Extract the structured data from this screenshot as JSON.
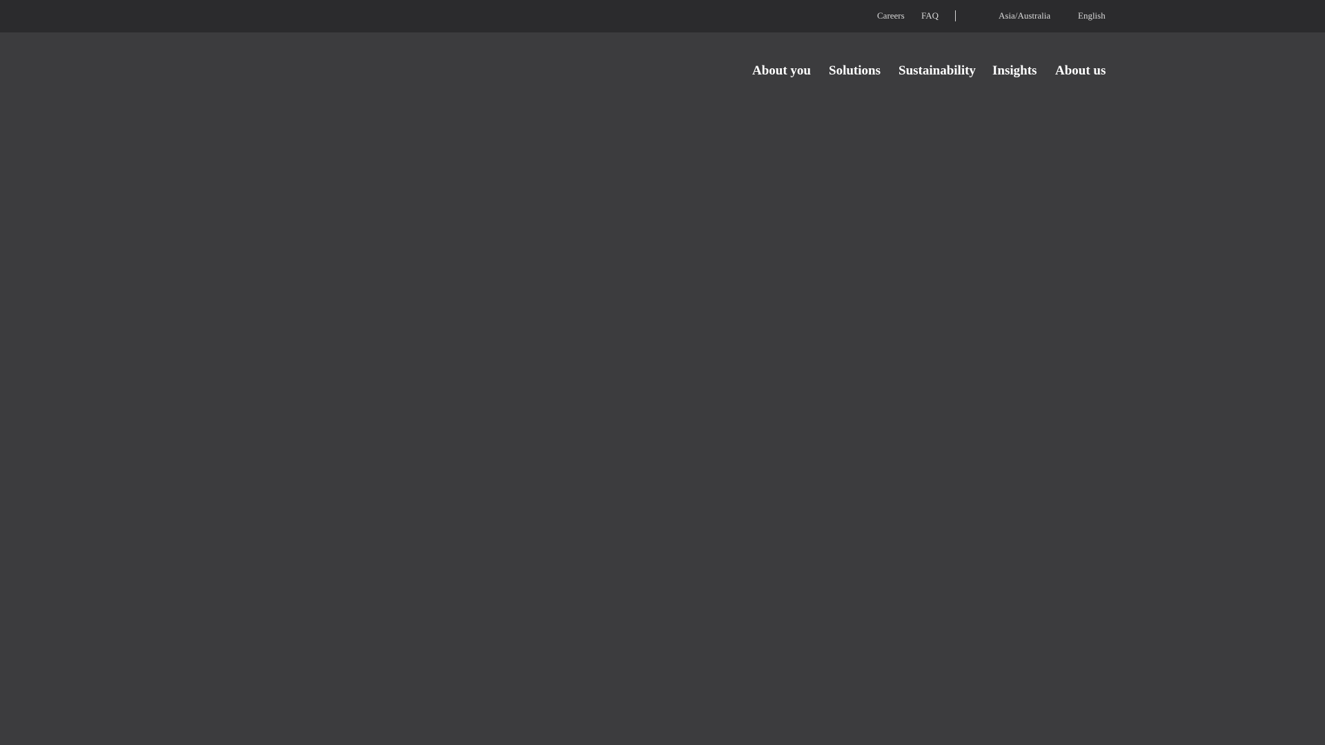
{
  "utility_nav": {
    "careers": "Careers",
    "faq": "FAQ",
    "region": "Asia/Australia",
    "language": "English"
  },
  "main_nav": {
    "items": [
      {
        "label": "About you"
      },
      {
        "label": "Solutions"
      },
      {
        "label": "Sustainability"
      },
      {
        "label": "Insights"
      },
      {
        "label": "About us"
      }
    ]
  },
  "colors": {
    "topbar_bg": "#2b2b2d",
    "page_bg": "#3c3c3e",
    "nav_text": "#ffffff",
    "util_text": "#d8d8d8"
  }
}
